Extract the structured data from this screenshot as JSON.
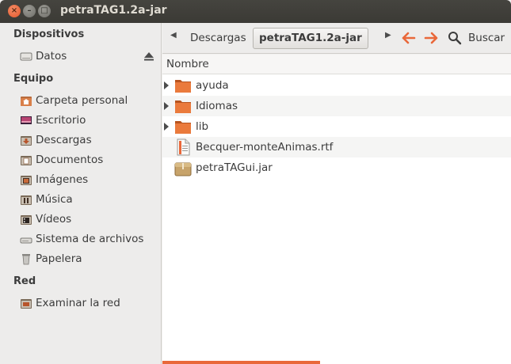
{
  "window": {
    "title": "petraTAG1.2a-jar",
    "close_glyph": "×",
    "minimize_glyph": "–",
    "maximize_glyph": "□"
  },
  "sidebar": {
    "sections": [
      {
        "title": "Dispositivos"
      },
      {
        "title": "Equipo"
      },
      {
        "title": "Red"
      }
    ],
    "devices": [
      {
        "label": "Datos",
        "icon": "drive-icon"
      }
    ],
    "computer": [
      {
        "label": "Carpeta personal",
        "icon": "home-folder-icon"
      },
      {
        "label": "Escritorio",
        "icon": "desktop-icon"
      },
      {
        "label": "Descargas",
        "icon": "downloads-folder-icon"
      },
      {
        "label": "Documentos",
        "icon": "documents-folder-icon"
      },
      {
        "label": "Imágenes",
        "icon": "pictures-folder-icon"
      },
      {
        "label": "Música",
        "icon": "music-folder-icon"
      },
      {
        "label": "Vídeos",
        "icon": "videos-folder-icon"
      },
      {
        "label": "Sistema de archivos",
        "icon": "filesystem-icon"
      },
      {
        "label": "Papelera",
        "icon": "trash-icon"
      }
    ],
    "network": [
      {
        "label": "Examinar la red",
        "icon": "network-icon"
      }
    ]
  },
  "toolbar": {
    "breadcrumb_parent": "Descargas",
    "breadcrumb_current": "petraTAG1.2a-jar",
    "search_label": "Buscar",
    "accent_color": "#e9683a"
  },
  "fileview": {
    "column_header": "Nombre",
    "files": [
      {
        "name": "ayuda",
        "type": "folder",
        "expandable": true
      },
      {
        "name": "Idiomas",
        "type": "folder",
        "expandable": true
      },
      {
        "name": "lib",
        "type": "folder",
        "expandable": true
      },
      {
        "name": "Becquer-monteAnimas.rtf",
        "type": "document",
        "expandable": false
      },
      {
        "name": "petraTAGui.jar",
        "type": "archive",
        "expandable": false
      }
    ]
  }
}
